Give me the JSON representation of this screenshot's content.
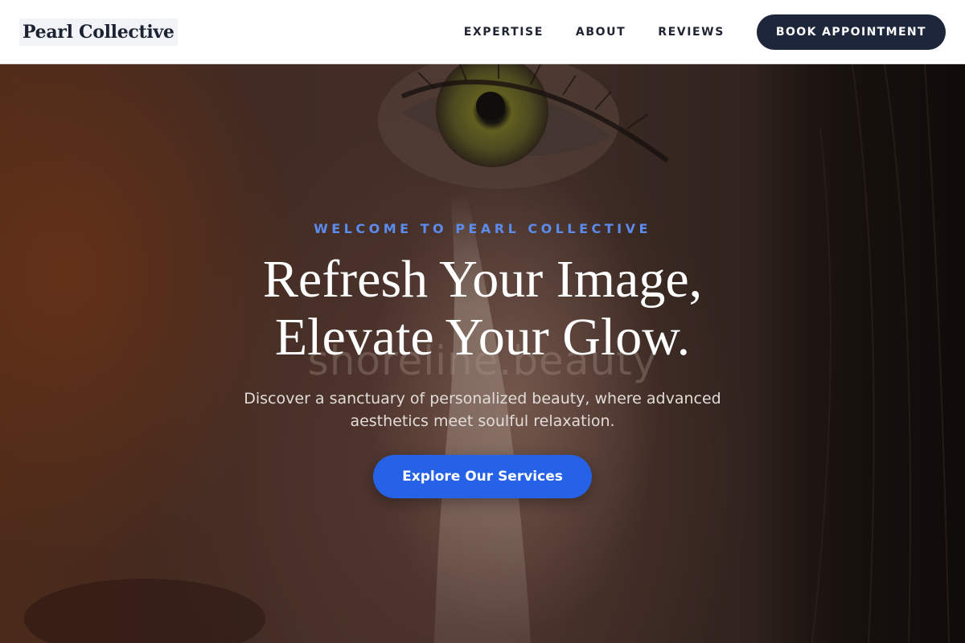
{
  "header": {
    "logo": "Pearl Collective",
    "nav": [
      "EXPERTISE",
      "ABOUT",
      "REVIEWS"
    ],
    "cta_label": "BOOK APPOINTMENT"
  },
  "hero": {
    "eyebrow": "WELCOME TO PEARL COLLECTIVE",
    "headline_line1": "Refresh Your Image,",
    "headline_line2": "Elevate Your Glow.",
    "ghost_text": "shoreline.beauty",
    "subtitle_line1": "Discover a sanctuary of personalized beauty, where advanced",
    "subtitle_line2": "aesthetics meet soulful relaxation.",
    "cta_label": "Explore Our Services",
    "background_image": "close-up-face-eye-photo"
  },
  "colors": {
    "accent": "#2562e8",
    "eyebrow": "#5b8cf0",
    "dark_button": "#1d263a",
    "header_bg": "#ffffff"
  }
}
